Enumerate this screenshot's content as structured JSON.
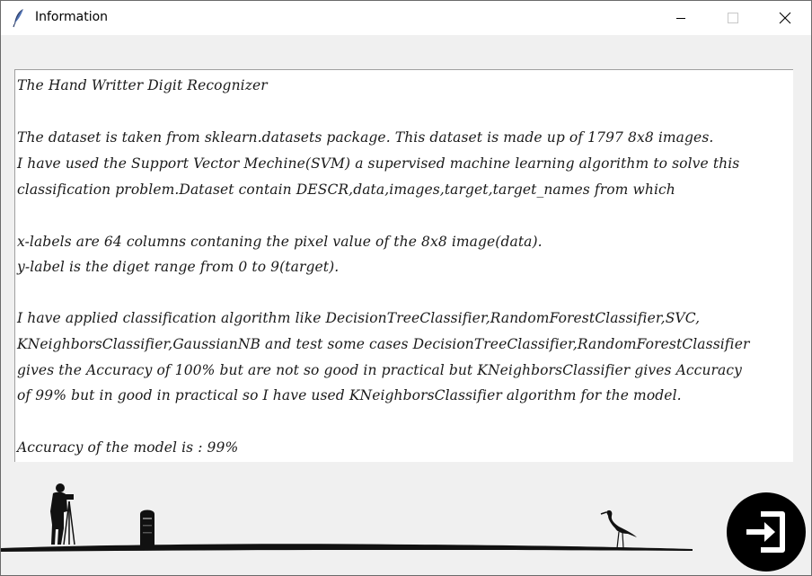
{
  "window": {
    "title": "Information"
  },
  "content": {
    "lines": [
      "The Hand Writter Digit Recognizer",
      "",
      "The dataset is taken from sklearn.datasets package. This dataset is made up of 1797 8x8 images.",
      "I have used the Support Vector Mechine(SVM) a supervised machine learning algorithm to solve this",
      "classification problem.Dataset contain DESCR,data,images,target,target_names from which",
      "",
      "x-labels are 64 columns contaning the pixel value of the 8x8 image(data).",
      "y-label is the diget range from 0 to 9(target).",
      "",
      "I have applied classification algorithm like DecisionTreeClassifier,RandomForestClassifier,SVC,",
      "KNeighborsClassifier,GaussianNB and test some cases DecisionTreeClassifier,RandomForestClassifier",
      "gives the Accuracy of 100% but are not so good in practical but KNeighborsClassifier gives Accuracy",
      "of 99% but in good in practical so I have used KNeighborsClassifier algorithm for the model.",
      "",
      "Accuracy of the model is : 99%"
    ]
  },
  "footer": {
    "exit_icon": "exit-door-icon",
    "decoration": [
      "photographer-silhouette",
      "post-box-silhouette",
      "stork-silhouette"
    ]
  },
  "colors": {
    "window_bg": "#f0f0f0",
    "text_bg": "#ffffff",
    "exit_button": "#000000"
  }
}
